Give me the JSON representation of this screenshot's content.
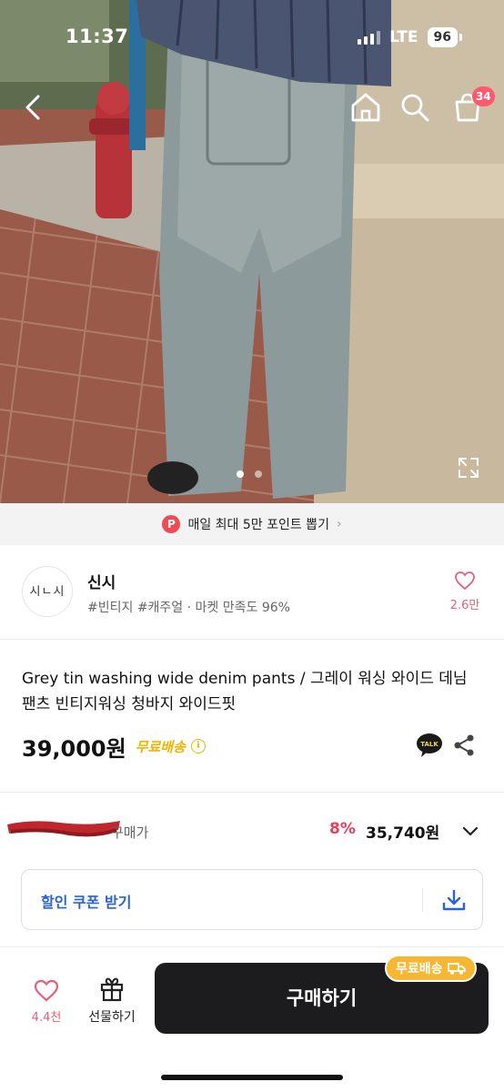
{
  "status_bar": {
    "time": "11:37",
    "network": "LTE",
    "battery": "96"
  },
  "nav": {
    "cart_count": "34"
  },
  "promo": {
    "badge": "P",
    "text": "매일 최대 5만 포인트 뽑기",
    "chevron": "›"
  },
  "seller": {
    "avatar_text": "시ㄴ시",
    "name": "신시",
    "tags": "#빈티지 #캐주얼 · 마켓 만족도 96%",
    "like_count": "2.6만"
  },
  "product": {
    "title": "Grey tin washing wide denim pants / 그레이 워싱 와이드 데님 팬츠 빈티지워싱 청바지 와이드핏",
    "price": "39,000원",
    "shipping_tag": "무료배송",
    "info_mark": "i"
  },
  "lowest_price": {
    "label": "구매가",
    "discount": "8%",
    "price": "35,740원"
  },
  "coupon": {
    "label": "할인 쿠폰 받기"
  },
  "bottom_bar": {
    "wish_count": "4.4천",
    "gift_label": "선물하기",
    "buy_label": "구매하기",
    "free_ship_badge": "무료배송"
  },
  "icons": {
    "back": "chevron-left-icon",
    "home": "home-icon",
    "search": "search-icon",
    "cart": "shopping-bag-icon",
    "expand": "expand-icon",
    "heart": "heart-icon",
    "talk": "kakaotalk-icon",
    "share": "share-icon",
    "chevron": "chevron-down-icon",
    "download": "download-icon",
    "gift": "gift-icon",
    "truck": "truck-icon"
  },
  "colors": {
    "accent_red": "#e8405a",
    "heart_pink": "#e5607a",
    "shipping_yellow": "#f0b400",
    "coupon_blue": "#2a63d6",
    "buy_button": "#1c1c1e"
  }
}
